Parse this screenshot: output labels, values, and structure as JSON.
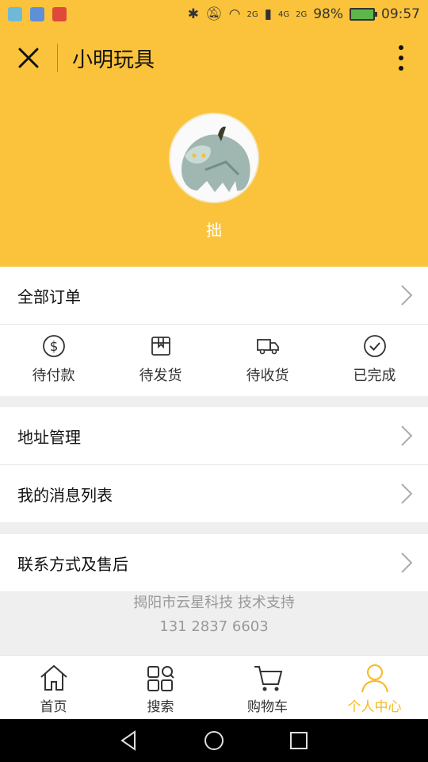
{
  "status_bar": {
    "network_top": "2G",
    "network_4g": "4G",
    "network_2g": "2G",
    "battery": "98%",
    "time": "09:57",
    "battery_color": "#5db64a"
  },
  "app": {
    "title": "小明玩具",
    "accent": "#fbc33c"
  },
  "profile": {
    "username": "拙"
  },
  "menu": {
    "all_orders": "全部订单",
    "order_states": [
      {
        "label": "待付款",
        "icon": "dollar-circle-icon"
      },
      {
        "label": "待发货",
        "icon": "package-icon"
      },
      {
        "label": "待收货",
        "icon": "truck-icon"
      },
      {
        "label": "已完成",
        "icon": "check-circle-icon"
      }
    ],
    "address": "地址管理",
    "messages": "我的消息列表",
    "contact": "联系方式及售后"
  },
  "footer": {
    "support": "揭阳市云星科技 技术支持",
    "phone": "131 2837 6603"
  },
  "tabs": [
    {
      "label": "首页",
      "icon": "home-icon"
    },
    {
      "label": "搜索",
      "icon": "search-grid-icon"
    },
    {
      "label": "购物车",
      "icon": "cart-icon"
    },
    {
      "label": "个人中心",
      "icon": "user-icon",
      "active": true
    }
  ],
  "active_color": "#f7b91c"
}
